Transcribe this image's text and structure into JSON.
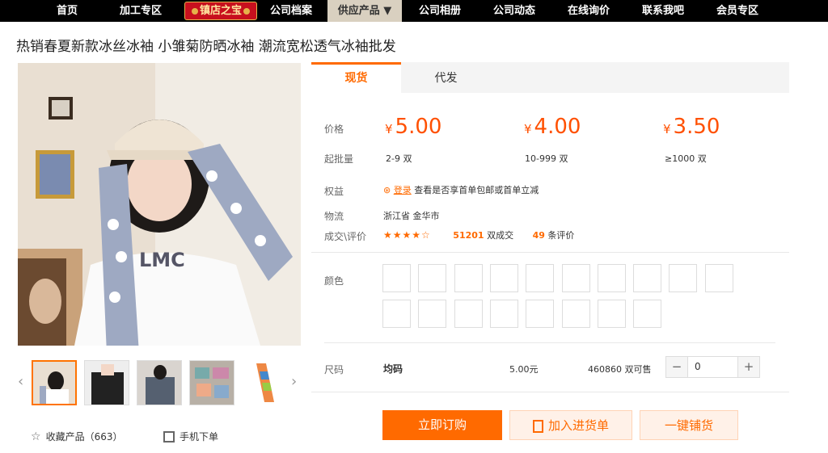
{
  "nav": {
    "items": [
      "首页",
      "加工专区",
      "公司档案",
      "供应产品 ▼",
      "公司相册",
      "公司动态",
      "在线询价",
      "联系我吧",
      "会员专区"
    ],
    "badge": "镇店之宝"
  },
  "product": {
    "title": "热销春夏新款冰丝冰袖 小雏菊防晒冰袖 潮流宽松透气冰袖批发"
  },
  "tabs": [
    "现货",
    "代发"
  ],
  "pricing": {
    "price_label": "价格",
    "moq_label": "起批量",
    "tiers": [
      {
        "price": "5.00",
        "qty": "2-9 双"
      },
      {
        "price": "4.00",
        "qty": "10-999 双"
      },
      {
        "price": "3.50",
        "qty": "≥1000 双"
      }
    ],
    "currency": "¥"
  },
  "benefits": {
    "label": "权益",
    "login": "登录",
    "text": "查看是否享首单包邮或首单立减"
  },
  "logistics": {
    "label": "物流",
    "value": "浙江省 金华市"
  },
  "reviews": {
    "label": "成交\\评价",
    "rating": 4.5,
    "deals": "51201",
    "deals_unit": "双成交",
    "reviews": "49",
    "reviews_unit": "条评价"
  },
  "color": {
    "label": "颜色",
    "swatch_count": 18
  },
  "size": {
    "label": "尺码",
    "value": "均码",
    "price": "5.00元",
    "stock": "460860 双可售",
    "quantity": "0",
    "minus": "−",
    "plus": "+"
  },
  "actions": {
    "buy": "立即订购",
    "add_cart": "加入进货单",
    "one_click": "一键铺货"
  },
  "footer": {
    "favorite": "收藏产品（663）",
    "mobile": "手机下单"
  },
  "colors": {
    "accent": "#ff6a00",
    "price": "#ff5000",
    "nav_bg": "#000000"
  }
}
